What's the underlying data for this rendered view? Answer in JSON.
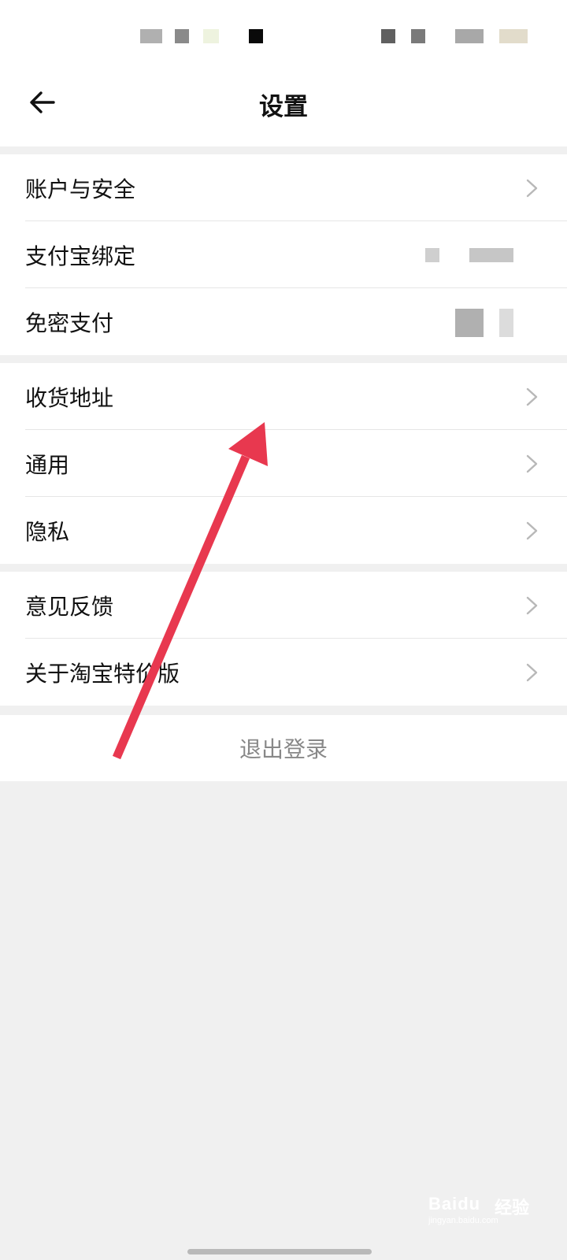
{
  "header": {
    "title": "设置",
    "back_icon": "arrow-left-icon"
  },
  "groups": [
    {
      "items": [
        {
          "label": "账户与安全",
          "trailing": "chevron-right-icon"
        },
        {
          "label": "支付宝绑定",
          "trailing": "blurred-value"
        },
        {
          "label": "免密支付",
          "trailing": "blurred-value"
        }
      ]
    },
    {
      "items": [
        {
          "label": "收货地址",
          "trailing": "chevron-right-icon"
        },
        {
          "label": "通用",
          "trailing": "chevron-right-icon"
        },
        {
          "label": "隐私",
          "trailing": "chevron-right-icon"
        }
      ]
    },
    {
      "items": [
        {
          "label": "意见反馈",
          "trailing": "chevron-right-icon"
        },
        {
          "label": "关于淘宝特价版",
          "trailing": "chevron-right-icon"
        }
      ]
    }
  ],
  "logout": {
    "label": "退出登录"
  },
  "watermark": {
    "brand": "Baidu",
    "suffix": "经验",
    "domain": "jingyan.baidu.com"
  },
  "colors": {
    "background": "#f0f0f0",
    "surface": "#ffffff",
    "annotation_arrow": "#e8384f",
    "chevron": "#b8b8b8",
    "logout_text": "#888888"
  }
}
